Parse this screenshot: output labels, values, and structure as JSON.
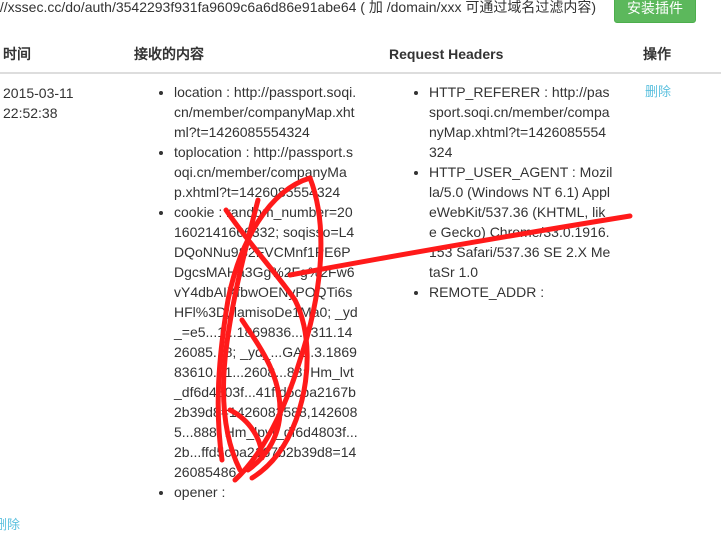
{
  "topbar": {
    "url_text": "://xssec.cc/do/auth/3542293f931fa9609c6a6d86e91abe64 ( 加 /domain/xxx 可通过域名过滤内容)",
    "install_button": "安装插件",
    "button_color": "#5cb85c"
  },
  "table": {
    "headers": {
      "time": "时间",
      "content": "接收的内容",
      "request_headers": "Request Headers",
      "actions": "操作"
    },
    "row": {
      "time_date": "2015-03-11",
      "time_clock": "22:52:38",
      "content": [
        "location : http://passport.soqi.cn/member/companyMap.xhtml?t=1426085554324",
        "toplocation : http://passport.soqi.cn/member/companyMap.xhtml?t=1426085554324",
        "cookie : random_number=201602141666332; soqisso=L4DQoNNu9S2FVCMnf1PE6PDgcsMAHa3Gg%2Fg%2Fw6vY4dbAIXfbwOENyPOQTi6sHFl%3D; lamisoDe1Ma0; _yd_=e5...1...1869836...5311.1426085...8; _yd_...GA1.3.186983610...1...2608...88; Hm_lvt_df6d4803f...41ffd5cba2167b2b39d8=1426083588,1426085...888; Hm_lpvt_df6d4803f...2b...ffd5cba2167b2b39d8=1426085486",
        "opener :"
      ],
      "headers": [
        "HTTP_REFERER : http://passport.soqi.cn/member/companyMap.xhtml?t=1426085554324",
        "HTTP_USER_AGENT : Mozilla/5.0 (Windows NT 6.1) AppleWebKit/537.36 (KHTML, like Gecko) Chrome/33.0.1916.153 Safari/537.36 SE 2.X MetaSr 1.0",
        "REMOTE_ADDR :"
      ],
      "delete_label": "删除"
    }
  },
  "footer": {
    "delete_label": "删除"
  },
  "colors": {
    "link": "#5bc0de",
    "scribble": "#ff1a1a",
    "rule": "#dddddd"
  }
}
